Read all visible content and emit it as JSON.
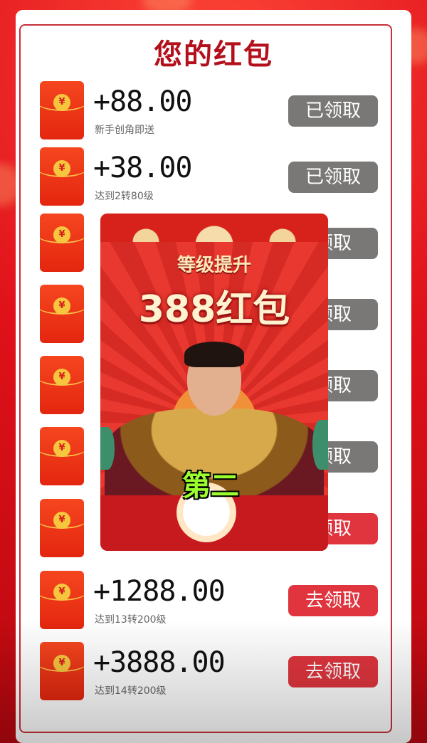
{
  "title": "您的红包",
  "envelope_icon": "red-envelope-icon",
  "envelope_symbol": "¥",
  "rows": [
    {
      "amount": "+88.00",
      "desc": "新手创角即送",
      "button": "已领取",
      "status": "claimed"
    },
    {
      "amount": "+38.00",
      "desc": "达到2转80级",
      "button": "已领取",
      "status": "claimed"
    },
    {
      "amount": "",
      "desc": "",
      "button": "领取",
      "status": "claimed"
    },
    {
      "amount": "",
      "desc": "",
      "button": "领取",
      "status": "claimed"
    },
    {
      "amount": "",
      "desc": "",
      "button": "领取",
      "status": "claimed"
    },
    {
      "amount": "",
      "desc": "",
      "button": "领取",
      "status": "claimed"
    },
    {
      "amount": "",
      "desc": "",
      "button": "领取",
      "status": "go"
    },
    {
      "amount": "+1288.00",
      "desc": "达到13转200级",
      "button": "去领取",
      "status": "go"
    },
    {
      "amount": "+3888.00",
      "desc": "达到14转200级",
      "button": "去领取",
      "status": "go"
    }
  ],
  "popup": {
    "subtitle": "等级提升",
    "headline": "388红包",
    "caption": "第二"
  },
  "colors": {
    "accent": "#b3101c",
    "claimed_button": "#7a7877",
    "go_button": "#e0353e",
    "caption": "#9bff2e"
  }
}
